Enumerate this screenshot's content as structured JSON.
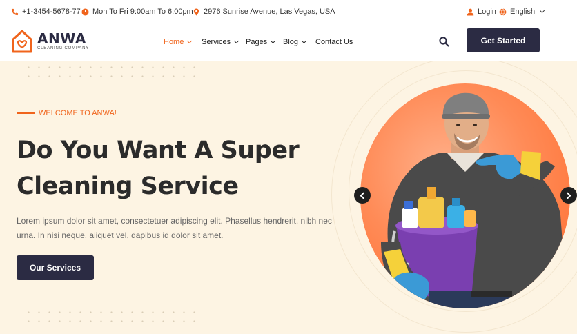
{
  "topbar": {
    "phone": "+1-3454-5678-77",
    "hours": "Mon To Fri 9:00am To 6:00pm",
    "address": "2976 Sunrise Avenue, Las Vegas, USA",
    "login": "Login",
    "language": "English"
  },
  "brand": {
    "name": "ANWA",
    "tagline": "CLEANING COMPANY",
    "accent": "#f0641c",
    "dark": "#2b2b43"
  },
  "nav": {
    "items": [
      {
        "label": "Home",
        "active": true
      },
      {
        "label": "Services"
      },
      {
        "label": "Pages"
      },
      {
        "label": "Blog"
      },
      {
        "label": "Contact Us"
      }
    ],
    "cta": "Get Started"
  },
  "hero": {
    "eyebrow": "WELCOME TO ANWA!",
    "title_line1": "Do You Want A Super",
    "title_line2": "Cleaning Service",
    "description": "Lorem ipsum dolor sit amet, consectetuer adipiscing elit. Phasellus hendrerit. nibh nec urna. In nisi neque, aliquet vel, dapibus id dolor sit amet.",
    "button": "Our Services"
  },
  "icons": {
    "phone": "phone-icon",
    "clock": "clock-icon",
    "location": "location-pin-icon",
    "user": "user-icon",
    "globe": "globe-icon",
    "search": "search-icon",
    "prev": "chevron-left-icon",
    "next": "chevron-right-icon"
  }
}
